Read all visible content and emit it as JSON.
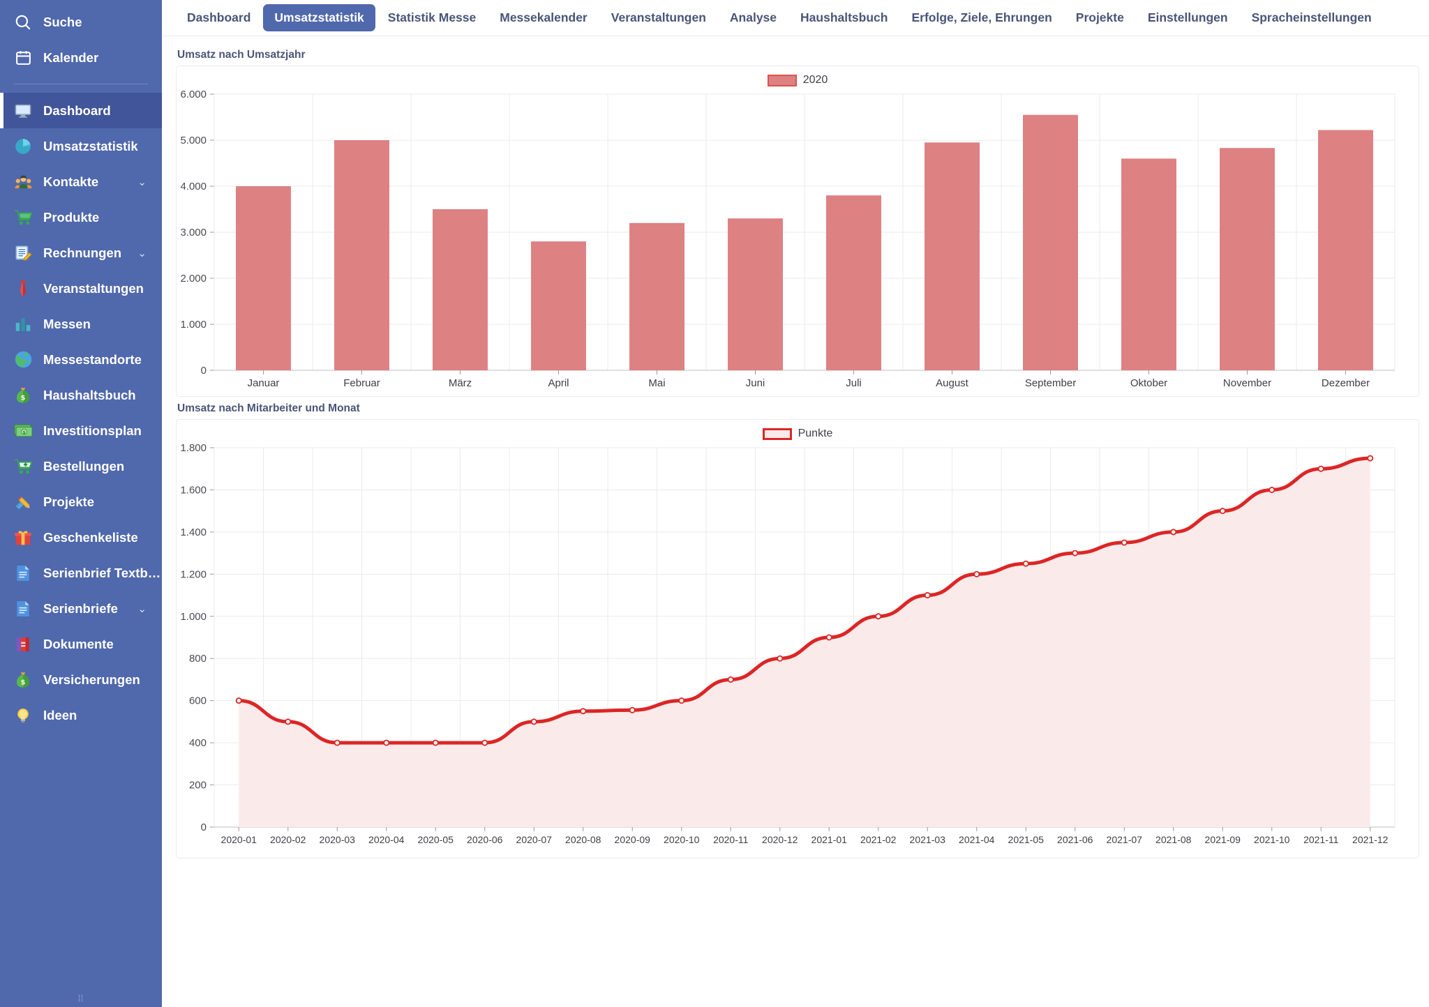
{
  "sidebar": {
    "top_items": [
      {
        "label": "Suche",
        "icon": "search-icon",
        "id": "suche"
      },
      {
        "label": "Kalender",
        "icon": "calendar-icon",
        "id": "kalender"
      }
    ],
    "items": [
      {
        "label": "Dashboard",
        "icon": "monitor-icon",
        "id": "dashboard",
        "active": true,
        "expandable": false
      },
      {
        "label": "Umsatzstatistik",
        "icon": "pie-chart-icon",
        "id": "umsatzstatistik",
        "active": false,
        "expandable": false
      },
      {
        "label": "Kontakte",
        "icon": "people-icon",
        "id": "kontakte",
        "active": false,
        "expandable": true
      },
      {
        "label": "Produkte",
        "icon": "cart-icon",
        "id": "produkte",
        "active": false,
        "expandable": false
      },
      {
        "label": "Rechnungen",
        "icon": "invoice-icon",
        "id": "rechnungen",
        "active": false,
        "expandable": true
      },
      {
        "label": "Veranstaltungen",
        "icon": "necktie-icon",
        "id": "veranstaltungen",
        "active": false,
        "expandable": false
      },
      {
        "label": "Messen",
        "icon": "bar-chart-icon",
        "id": "messen",
        "active": false,
        "expandable": false
      },
      {
        "label": "Messestandorte",
        "icon": "globe-icon",
        "id": "messestandorte",
        "active": false,
        "expandable": false
      },
      {
        "label": "Haushaltsbuch",
        "icon": "money-bag-icon",
        "id": "haushaltsbuch",
        "active": false,
        "expandable": false
      },
      {
        "label": "Investitionsplan",
        "icon": "banknote-icon",
        "id": "investitionsplan",
        "active": false,
        "expandable": false
      },
      {
        "label": "Bestellungen",
        "icon": "cart-plus-icon",
        "id": "bestellungen",
        "active": false,
        "expandable": false
      },
      {
        "label": "Projekte",
        "icon": "ruler-pencil-icon",
        "id": "projekte",
        "active": false,
        "expandable": false
      },
      {
        "label": "Geschenkeliste",
        "icon": "gift-icon",
        "id": "geschenkeliste",
        "active": false,
        "expandable": false
      },
      {
        "label": "Serienbrief Textb…",
        "icon": "document-icon",
        "id": "serienbrief-textb",
        "active": false,
        "expandable": false
      },
      {
        "label": "Serienbriefe",
        "icon": "document-icon",
        "id": "serienbriefe",
        "active": false,
        "expandable": true
      },
      {
        "label": "Dokumente",
        "icon": "books-icon",
        "id": "dokumente",
        "active": false,
        "expandable": false
      },
      {
        "label": "Versicherungen",
        "icon": "money-bag-icon",
        "id": "versicherungen",
        "active": false,
        "expandable": false
      },
      {
        "label": "Ideen",
        "icon": "lightbulb-icon",
        "id": "ideen",
        "active": false,
        "expandable": false
      }
    ],
    "chevron_glyph": "⌄",
    "resize_handle": "⦙⦙",
    "accent_color": "#5068ac",
    "active_color": "#41559a"
  },
  "tabs": [
    {
      "label": "Dashboard",
      "active": false
    },
    {
      "label": "Umsatzstatistik",
      "active": true
    },
    {
      "label": "Statistik Messe",
      "active": false
    },
    {
      "label": "Messekalender",
      "active": false
    },
    {
      "label": "Veranstaltungen",
      "active": false
    },
    {
      "label": "Analyse",
      "active": false
    },
    {
      "label": "Haushaltsbuch",
      "active": false
    },
    {
      "label": "Erfolge, Ziele, Ehrungen",
      "active": false
    },
    {
      "label": "Projekte",
      "active": false
    },
    {
      "label": "Einstellungen",
      "active": false
    },
    {
      "label": "Spracheinstellungen",
      "active": false
    }
  ],
  "chart_data": [
    {
      "type": "bar",
      "title": "Umsatz nach Umsatzjahr",
      "xlabel": "",
      "ylabel": "",
      "ylim": [
        0,
        6000
      ],
      "yticks": [
        0,
        1000,
        2000,
        3000,
        4000,
        5000,
        6000
      ],
      "ytick_labels": [
        "0",
        "1.000",
        "2.000",
        "3.000",
        "4.000",
        "5.000",
        "6.000"
      ],
      "grid": true,
      "legend": {
        "position": "top-center",
        "entries": [
          "2020"
        ]
      },
      "series": [
        {
          "name": "2020",
          "color": "#dd8183",
          "values": [
            4000,
            5000,
            3500,
            2800,
            3200,
            3300,
            3800,
            4950,
            5550,
            4600,
            4830,
            5220
          ]
        }
      ],
      "categories": [
        "Januar",
        "Februar",
        "März",
        "April",
        "Mai",
        "Juni",
        "Juli",
        "August",
        "September",
        "Oktober",
        "November",
        "Dezember"
      ]
    },
    {
      "type": "area",
      "title": "Umsatz nach Mitarbeiter und Monat",
      "xlabel": "",
      "ylabel": "",
      "ylim": [
        0,
        1800
      ],
      "yticks": [
        0,
        200,
        400,
        600,
        800,
        1000,
        1200,
        1400,
        1600,
        1800
      ],
      "ytick_labels": [
        "0",
        "200",
        "400",
        "600",
        "800",
        "1.000",
        "1.200",
        "1.400",
        "1.600",
        "1.800"
      ],
      "grid": true,
      "legend": {
        "position": "top-center",
        "entries": [
          "Punkte"
        ]
      },
      "series": [
        {
          "name": "Punkte",
          "color": "#dc2626",
          "fill": "#fbeaea",
          "values": [
            600,
            500,
            400,
            400,
            400,
            400,
            500,
            550,
            555,
            600,
            700,
            800,
            900,
            1000,
            1100,
            1200,
            1250,
            1300,
            1350,
            1400,
            1500,
            1600,
            1700,
            1750
          ]
        }
      ],
      "categories": [
        "2020-01",
        "2020-02",
        "2020-03",
        "2020-04",
        "2020-05",
        "2020-06",
        "2020-07",
        "2020-08",
        "2020-09",
        "2020-10",
        "2020-11",
        "2020-12",
        "2021-01",
        "2021-02",
        "2021-03",
        "2021-04",
        "2021-05",
        "2021-06",
        "2021-07",
        "2021-08",
        "2021-09",
        "2021-10",
        "2021-11",
        "2021-12"
      ]
    }
  ]
}
